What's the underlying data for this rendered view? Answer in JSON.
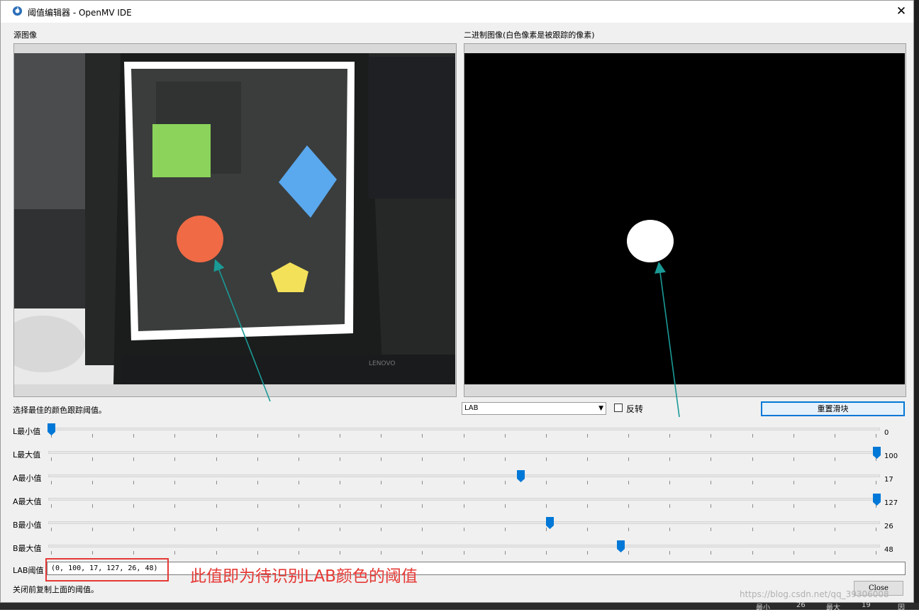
{
  "window": {
    "title": "阈值编辑器 - OpenMV IDE",
    "close_symbol": "✕"
  },
  "panels": {
    "source_label": "源图像",
    "binary_label": "二进制图像(白色像素是被跟踪的像素)"
  },
  "controls": {
    "instruction": "选择最佳的颜色跟踪阈值。",
    "color_space": "LAB",
    "invert_label": "反转",
    "invert_checked": false,
    "reset_button": "重置滑块"
  },
  "sliders": [
    {
      "label": "L最小值",
      "value": "0",
      "fraction": 0.0
    },
    {
      "label": "L最大值",
      "value": "100",
      "fraction": 1.0
    },
    {
      "label": "A最小值",
      "value": "17",
      "fraction": 0.569
    },
    {
      "label": "A最大值",
      "value": "127",
      "fraction": 1.0
    },
    {
      "label": "B最小值",
      "value": "26",
      "fraction": 0.604
    },
    {
      "label": "B最大值",
      "value": "48",
      "fraction": 0.69
    }
  ],
  "lab_threshold": {
    "label": "LAB阈值",
    "value": "(0, 100, 17, 127, 26, 48)"
  },
  "footer": {
    "note": "关闭前复制上面的阈值。",
    "close_button": "Close"
  },
  "annotation": {
    "text": "此值即为待识别LAB颜色的阈值",
    "color": "#e53935"
  },
  "watermark": "https://blog.csdn.net/qq_39306008",
  "taskbar_bits": [
    "最小",
    "26",
    "最大",
    "19",
    "因"
  ],
  "colors": {
    "accent": "#0078d7",
    "green_square": "#8bd35a",
    "blue_diamond": "#5aa8ee",
    "red_circle": "#ef6a45",
    "yellow_pentagon": "#f3e15a",
    "arrow_teal": "#1a9a96"
  },
  "icons": {
    "app": "openmv-logo-icon",
    "close": "close-icon",
    "dropdown": "chevron-down-icon"
  }
}
